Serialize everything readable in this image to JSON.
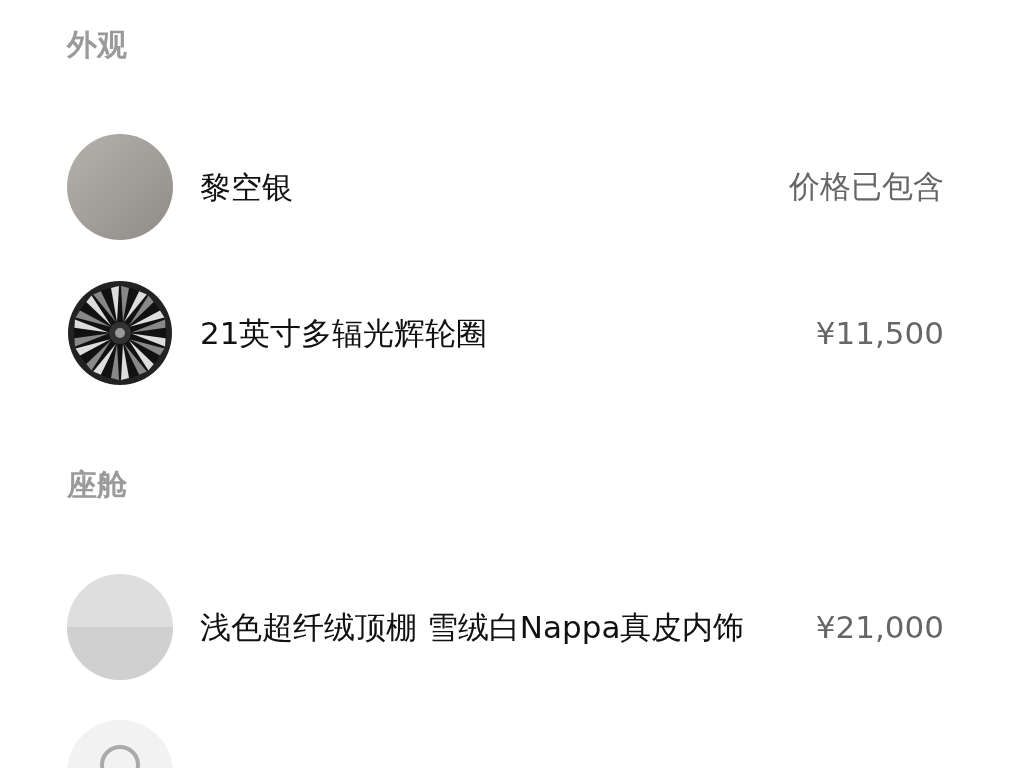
{
  "sections": [
    {
      "title": "外观",
      "items": [
        {
          "kind": "paint",
          "name": "黎空银",
          "price": "价格已包含"
        },
        {
          "kind": "wheel",
          "name": "21英寸多辐光辉轮圈",
          "price": "¥11,500"
        }
      ]
    },
    {
      "title": "座舱",
      "items": [
        {
          "kind": "interior",
          "name": "浅色超纤绒顶棚 雪绒白Nappa真皮内饰",
          "price": "¥21,000"
        },
        {
          "kind": "trim"
        }
      ]
    }
  ]
}
